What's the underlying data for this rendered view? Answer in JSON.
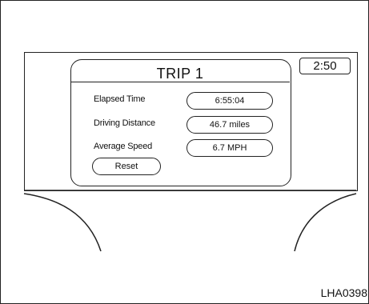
{
  "trip": {
    "title": "TRIP 1",
    "rows": [
      {
        "label": "Elapsed Time",
        "value": "6:55:04"
      },
      {
        "label": "Driving Distance",
        "value": "46.7 miles"
      },
      {
        "label": "Average Speed",
        "value": "6.7 MPH"
      }
    ],
    "reset_label": "Reset"
  },
  "clock": {
    "time": "2:50"
  },
  "figure_code": "LHA0398"
}
